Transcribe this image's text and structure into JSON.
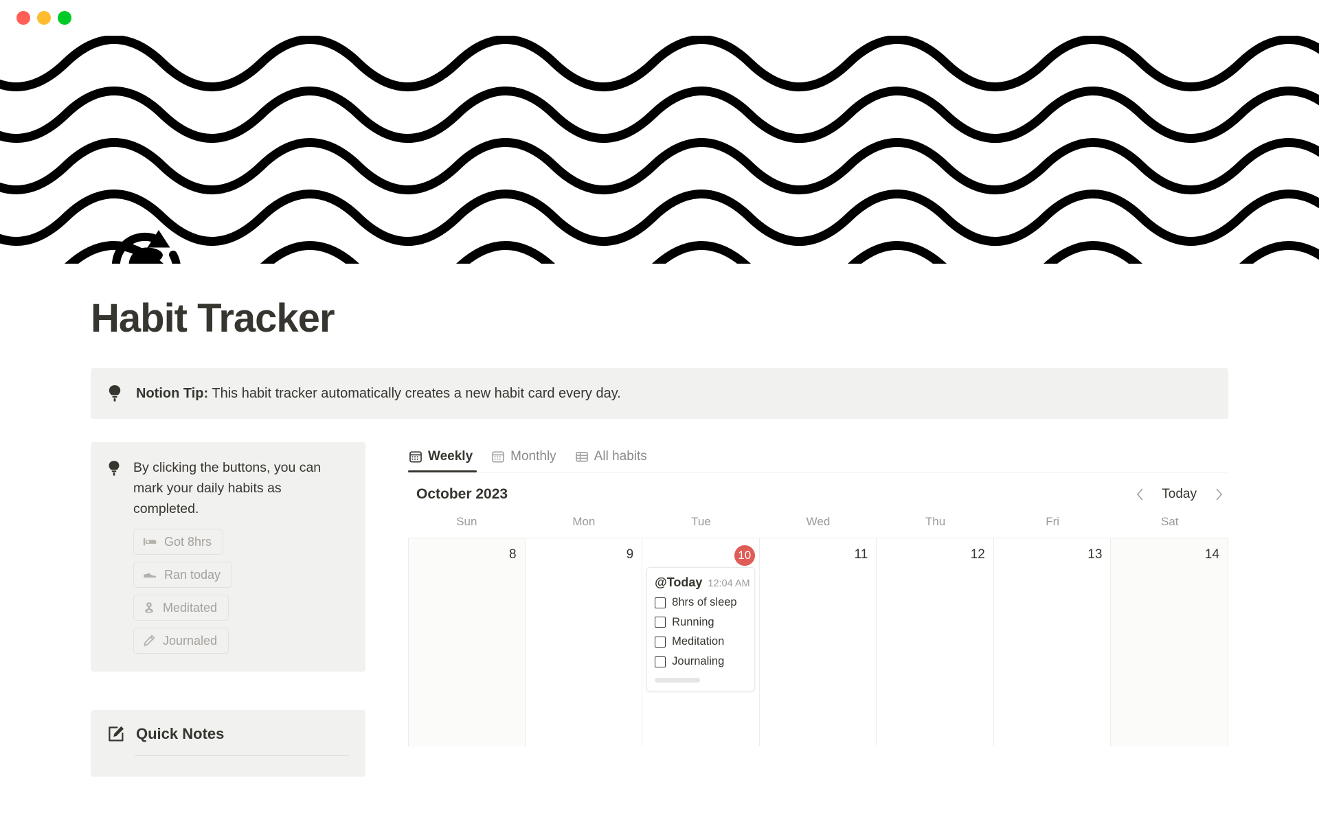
{
  "window": {
    "traffic_lights": [
      {
        "name": "close",
        "color": "#ff5f57"
      },
      {
        "name": "minimize",
        "color": "#febc2e"
      },
      {
        "name": "maximize",
        "color": "#00ca26"
      }
    ]
  },
  "banner": {
    "icon": "habit-loop-head-icon",
    "pattern": "wave-pattern",
    "wave_color": "#000000",
    "background": "#ffffff"
  },
  "header": {
    "title": "Habit Tracker"
  },
  "top_callout": {
    "icon": "lightbulb-icon",
    "label_bold": "Notion Tip:",
    "text": " This habit tracker automatically creates a new habit card every day.",
    "background": "#f1f1ef"
  },
  "side_callout": {
    "icon": "lightbulb-icon",
    "text": "By clicking the buttons, you can mark your daily habits as completed.",
    "background": "#f1f1ef",
    "buttons": [
      {
        "label": "Got 8hrs",
        "icon": "bed-icon"
      },
      {
        "label": "Ran today",
        "icon": "shoe-icon"
      },
      {
        "label": "Meditated",
        "icon": "meditation-icon"
      },
      {
        "label": "Journaled",
        "icon": "pencil-icon"
      }
    ]
  },
  "quick_notes": {
    "icon": "edit-square-icon",
    "title": "Quick Notes"
  },
  "tabs": [
    {
      "label": "Weekly",
      "icon": "calendar-icon",
      "active": true
    },
    {
      "label": "Monthly",
      "icon": "calendar-icon",
      "active": false
    },
    {
      "label": "All habits",
      "icon": "table-icon",
      "active": false
    }
  ],
  "calendar": {
    "month_label": "October 2023",
    "today_label": "Today",
    "prev_icon": "chevron-left-icon",
    "next_icon": "chevron-right-icon",
    "weekdays": [
      "Sun",
      "Mon",
      "Tue",
      "Wed",
      "Thu",
      "Fri",
      "Sat"
    ],
    "today_badge_color": "#e05c57",
    "days": [
      {
        "number": "8",
        "is_today": false,
        "weekend": true
      },
      {
        "number": "9",
        "is_today": false,
        "weekend": false
      },
      {
        "number": "10",
        "is_today": true,
        "weekend": false
      },
      {
        "number": "11",
        "is_today": false,
        "weekend": false
      },
      {
        "number": "12",
        "is_today": false,
        "weekend": false
      },
      {
        "number": "13",
        "is_today": false,
        "weekend": false
      },
      {
        "number": "14",
        "is_today": false,
        "weekend": true
      }
    ],
    "event_card": {
      "title": "@Today",
      "time": "12:04 AM",
      "day_index": 2,
      "checkboxes": [
        {
          "label": "8hrs of sleep",
          "checked": false
        },
        {
          "label": "Running",
          "checked": false
        },
        {
          "label": "Meditation",
          "checked": false
        },
        {
          "label": "Journaling",
          "checked": false
        }
      ]
    }
  }
}
